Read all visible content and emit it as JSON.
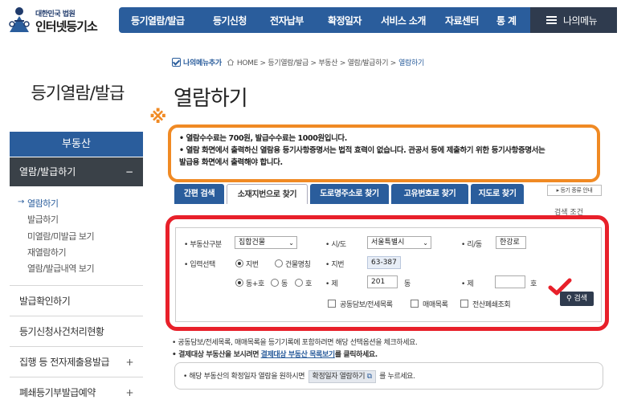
{
  "header": {
    "logo_small": "대한민국 법원",
    "logo_big": "인터넷등기소",
    "nav": [
      "등기열람/발급",
      "등기신청",
      "전자납부",
      "확정일자",
      "서비스 소개",
      "자료센터",
      "통 계"
    ],
    "my_menu": "나의메뉴"
  },
  "sidebar": {
    "title": "등기열람/발급",
    "main": "부동산",
    "sub": "열람/발급하기",
    "sub_toggle": "−",
    "links": [
      "열람하기",
      "발급하기",
      "미열람/미발급 보기",
      "재열람하기",
      "열람/발급내역 보기"
    ],
    "items": [
      "발급확인하기",
      "등기신청사건처리현황",
      "집행 등 전자제출용발급",
      "폐쇄등기부발급예약"
    ],
    "plus": "+"
  },
  "breadcrumb": {
    "add_label": "나의메뉴추가",
    "path": "HOME > 등기열람/발급 > 부동산 > 열람/발급하기 >",
    "current": "열람하기"
  },
  "page_title": "열람하기",
  "mark": "※",
  "notice": [
    "• 열람수수료는 700원, 발급수수료는 1000원입니다.",
    "• 열람 화면에서 출력하신 열람용 등기사항증명서는 법적 효력이 없습니다. 관공서 등에 제출하기 위한 등기사항증명서는",
    "  발급용 화면에서 출력해야 합니다."
  ],
  "tabs": [
    "간편 검색",
    "소재지번으로 찾기",
    "도로명주소로 찾기",
    "고유번호로 찾기",
    "지도로 찾기"
  ],
  "kind_guide": "▸ 등기 종류 안내",
  "condition_label": "검색 조건",
  "form": {
    "type_label": "• 부동산구분",
    "type_value": "집합건물",
    "sido_label": "• 시/도",
    "sido_value": "서울특별시",
    "ri_label": "• 리/동",
    "ri_value": "한강로",
    "input_label": "• 입력선택",
    "radio1": [
      "지번",
      "건물명칭"
    ],
    "jibun_label": "• 지번",
    "jibun_value": "63-387",
    "radio2": [
      "동+호",
      "동",
      "호"
    ],
    "dong_label": "• 제",
    "dong_value": "201",
    "dong_unit": "동",
    "ho_label": "• 제",
    "ho_value": "",
    "ho_unit": "호",
    "checks": [
      "공동담보/전세목록",
      "매매목록",
      "전산폐쇄조회"
    ],
    "search_btn": "검색"
  },
  "notes": {
    "line1": "• 공동담보/전세목록, 매매목록을 등기기록에 포함하려면 해당 선택옵션을 체크하세요.",
    "line2_pre": "• 결제대상 부동산을 보시려면",
    "line2_link": "결제대상 부동산 목록보기",
    "line2_post": "를 클릭하세요.",
    "info_pre": "• 해당 부동산의 확정일자 열람을 원하시면",
    "info_btn": "확정일자 열람하기",
    "info_post": "를 누르세요."
  },
  "colors": {
    "primary": "#2a5d9c",
    "dark": "#2f3b4e",
    "orange": "#f08a24",
    "red": "#e8202a"
  }
}
